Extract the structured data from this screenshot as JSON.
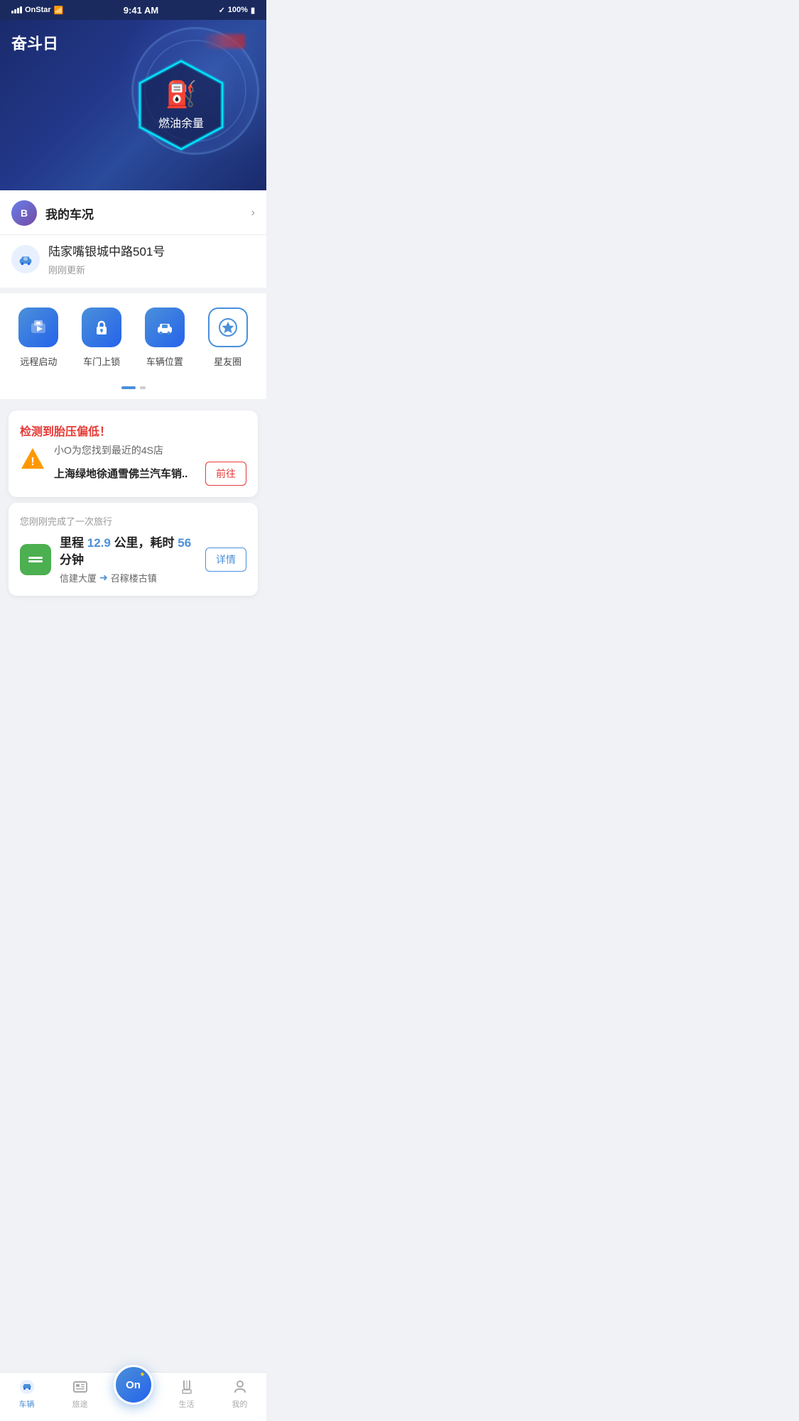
{
  "statusBar": {
    "carrier": "OnStar",
    "time": "9:41 AM",
    "bluetooth": "BT",
    "battery": "100%"
  },
  "hero": {
    "title": "奋斗日",
    "fuelLabel": "燃油余量"
  },
  "carStatus": {
    "label": "我的车况",
    "chevron": "›"
  },
  "location": {
    "address": "陆家嘴银城中路501号",
    "updateTime": "刚刚更新"
  },
  "quickActions": [
    {
      "id": "remote-start",
      "label": "远程启动",
      "icon": "▶",
      "style": "filled"
    },
    {
      "id": "door-lock",
      "label": "车门上锁",
      "icon": "🔒",
      "style": "filled"
    },
    {
      "id": "car-location",
      "label": "车辆位置",
      "icon": "🚗",
      "style": "filled"
    },
    {
      "id": "star-circle",
      "label": "星友圈",
      "icon": "★",
      "style": "outline"
    }
  ],
  "alert": {
    "title": "检测到胎压偏低！",
    "subtitle": "小O为您找到最近的4S店",
    "dealerName": "上海绿地徐通雪佛兰汽车销..",
    "gotoLabel": "前往"
  },
  "trip": {
    "subtitle": "您刚刚完成了一次旅行",
    "distanceLabel": "里程",
    "distanceValue": "12.9",
    "distanceUnit": "公里，耗时",
    "timeValue": "56",
    "timeUnit": "分钟",
    "from": "信建大厦",
    "to": "召稼楼古镇",
    "detailLabel": "详情"
  },
  "bottomNav": {
    "items": [
      {
        "id": "vehicle",
        "label": "车辆",
        "active": true
      },
      {
        "id": "journey",
        "label": "旅途",
        "active": false
      },
      {
        "id": "center",
        "label": "On",
        "active": false,
        "isCenter": true
      },
      {
        "id": "life",
        "label": "生活",
        "active": false
      },
      {
        "id": "mine",
        "label": "我的",
        "active": false
      }
    ]
  }
}
